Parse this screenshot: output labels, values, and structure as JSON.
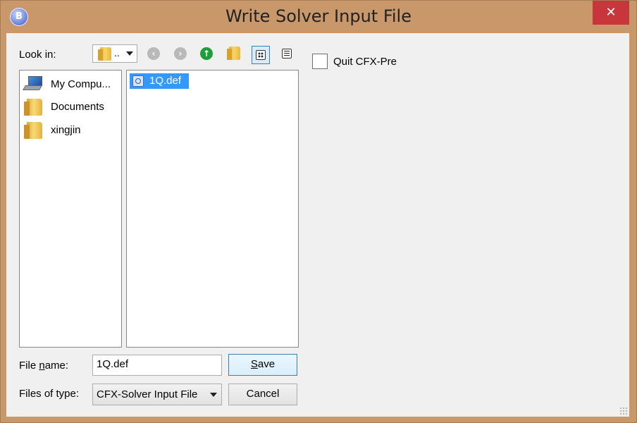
{
  "window": {
    "title": "Write Solver Input File",
    "close_glyph": "✕"
  },
  "toolbar": {
    "look_in_label": "Look in:",
    "look_in_value": "..",
    "back_glyph": "‹",
    "forward_glyph": "›",
    "up_glyph": "↑"
  },
  "sidebar": {
    "items": [
      {
        "label": "My Compu..."
      },
      {
        "label": "Documents"
      },
      {
        "label": "xingjin"
      }
    ]
  },
  "files": [
    {
      "label": "1Q.def"
    }
  ],
  "options": {
    "quit_label": "Quit CFX-Pre"
  },
  "form": {
    "file_name_label_pre": "File ",
    "file_name_label_u": "n",
    "file_name_label_post": "ame:",
    "file_name_value": "1Q.def",
    "files_of_type_label": "Files of type:",
    "files_of_type_value": "CFX-Solver Input File",
    "save_label_u": "S",
    "save_label_rest": "ave",
    "cancel_label": "Cancel"
  },
  "colors": {
    "frame": "#c8976a",
    "close": "#c7363a",
    "selection": "#3399ff",
    "up_arrow": "#1e9e3a"
  }
}
